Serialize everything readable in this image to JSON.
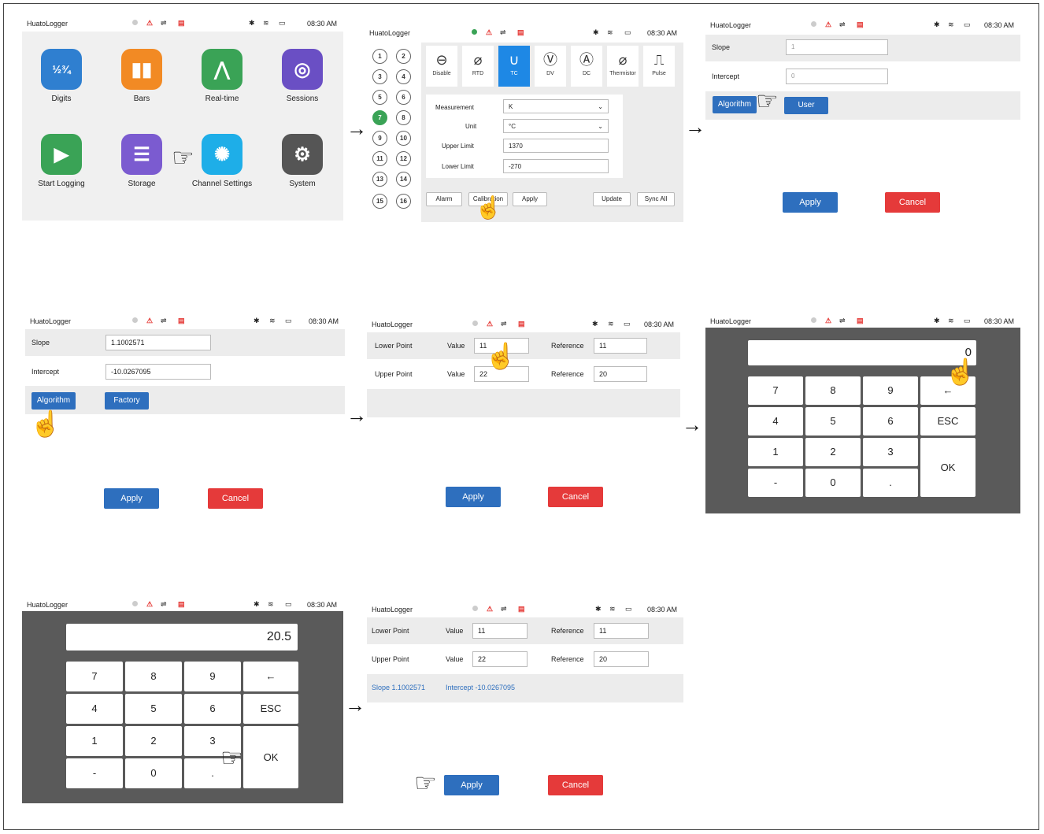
{
  "status": {
    "app": "HuatoLogger",
    "time": "08:30 AM"
  },
  "home": {
    "apps": [
      {
        "label": "Digits",
        "icon": "digits-icon",
        "color": "#2f7fd0"
      },
      {
        "label": "Bars",
        "icon": "bars-icon",
        "color": "#f28a24"
      },
      {
        "label": "Real-time",
        "icon": "realtime-icon",
        "color": "#3aa356"
      },
      {
        "label": "Sessions",
        "icon": "sessions-icon",
        "color": "#6a4fc4"
      },
      {
        "label": "Start Logging",
        "icon": "play-icon",
        "color": "#3aa356"
      },
      {
        "label": "Storage",
        "icon": "storage-icon",
        "color": "#7b5bd0"
      },
      {
        "label": "Channel Settings",
        "icon": "channel-settings-icon",
        "color": "#1eaee8"
      },
      {
        "label": "System",
        "icon": "gear-icon",
        "color": "#555555"
      }
    ]
  },
  "channel": {
    "numbers": [
      "1",
      "2",
      "3",
      "4",
      "5",
      "6",
      "7",
      "8",
      "9",
      "10",
      "11",
      "12",
      "13",
      "14",
      "15",
      "16"
    ],
    "selected": "7",
    "types": [
      {
        "label": "Disable",
        "glyph": "⊖"
      },
      {
        "label": "RTD",
        "glyph": "⌀"
      },
      {
        "label": "TC",
        "glyph": "∪"
      },
      {
        "label": "DV",
        "glyph": "Ⓥ"
      },
      {
        "label": "DC",
        "glyph": "Ⓐ"
      },
      {
        "label": "Thermistor",
        "glyph": "⌀"
      },
      {
        "label": "Pulse",
        "glyph": "⎍"
      }
    ],
    "measurement_label": "Measurement",
    "measurement_value": "K",
    "unit_label": "Unit",
    "unit_value": "°C",
    "upper_label": "Upper Limit",
    "upper_value": "1370",
    "lower_label": "Lower Limit",
    "lower_value": "-270",
    "buttons": {
      "alarm": "Alarm",
      "calibration": "Calibration",
      "apply": "Apply",
      "update": "Update",
      "sync": "Sync All"
    }
  },
  "calib_user": {
    "slope_label": "Slope",
    "slope_value": "1",
    "intercept_label": "Intercept",
    "intercept_value": "0",
    "algorithm": "Algorithm",
    "user": "User"
  },
  "calib_factory": {
    "slope_label": "Slope",
    "slope_value": "1.1002571",
    "intercept_label": "Intercept",
    "intercept_value": "-10.0267095",
    "algorithm": "Algorithm",
    "factory": "Factory"
  },
  "points": {
    "lower_label": "Lower Point",
    "upper_label": "Upper Point",
    "value_label": "Value",
    "reference_label": "Reference",
    "lower_value": "11",
    "lower_reference": "11",
    "upper_value": "22",
    "upper_reference": "20"
  },
  "keypad": {
    "display_empty": "0",
    "display_filled": "20.5",
    "keys": [
      "7",
      "8",
      "9",
      "←",
      "4",
      "5",
      "6",
      "ESC",
      "1",
      "2",
      "3",
      "OK",
      "-",
      "0",
      "."
    ]
  },
  "result": {
    "lower_value": "11",
    "upper_value": "22",
    "lower_reference": "11",
    "upper_reference": "20",
    "slope": "Slope  1.1002571",
    "intercept": "Intercept  -10.0267095"
  },
  "actions": {
    "apply": "Apply",
    "cancel": "Cancel"
  }
}
